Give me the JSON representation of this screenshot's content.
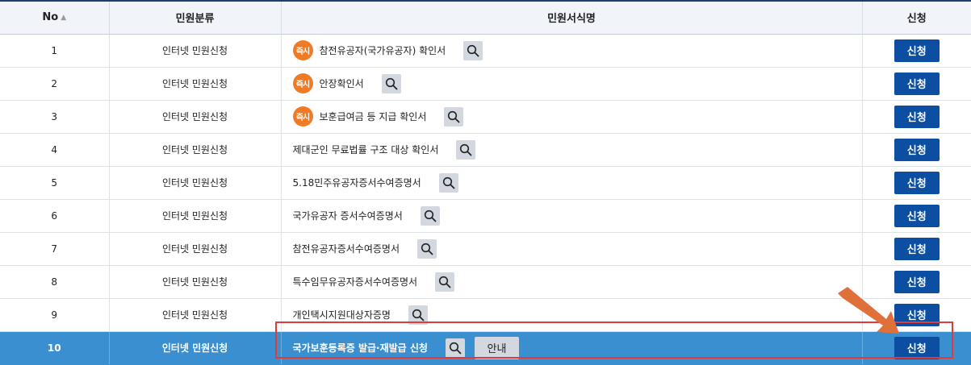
{
  "header": {
    "col_no": "No",
    "col_category": "민원분류",
    "col_form": "민원서식명",
    "col_apply": "신청"
  },
  "badge_label": "즉시",
  "apply_label": "신청",
  "guide_label": "안내",
  "rows": [
    {
      "no": "1",
      "category": "인터넷 민원신청",
      "title": "참전유공자(국가유공자) 확인서",
      "instant": true
    },
    {
      "no": "2",
      "category": "인터넷 민원신청",
      "title": "안장확인서",
      "instant": true
    },
    {
      "no": "3",
      "category": "인터넷 민원신청",
      "title": "보훈급여금 등 지급 확인서",
      "instant": true
    },
    {
      "no": "4",
      "category": "인터넷 민원신청",
      "title": "제대군인 무료법률 구조 대상 확인서",
      "instant": false
    },
    {
      "no": "5",
      "category": "인터넷 민원신청",
      "title": "5.18민주유공자증서수여증명서",
      "instant": false
    },
    {
      "no": "6",
      "category": "인터넷 민원신청",
      "title": "국가유공자 증서수여증명서",
      "instant": false
    },
    {
      "no": "7",
      "category": "인터넷 민원신청",
      "title": "참전유공자증서수여증명서",
      "instant": false
    },
    {
      "no": "8",
      "category": "인터넷 민원신청",
      "title": "특수임무유공자증서수여증명서",
      "instant": false
    },
    {
      "no": "9",
      "category": "인터넷 민원신청",
      "title": "개인택시지원대상자증명",
      "instant": false
    },
    {
      "no": "10",
      "category": "인터넷 민원신청",
      "title": "국가보훈등록증 발급·재발급 신청",
      "instant": false,
      "selected": true,
      "has_guide": true
    }
  ],
  "colors": {
    "badge": "#f07b24",
    "apply_button": "#0b4ea2",
    "selected_row": "#3a8fd0",
    "highlight_border": "#e03a3a",
    "arrow": "#e0703a"
  },
  "icons": {
    "sort": "sort-icon",
    "search": "magnifier-icon",
    "pointer": "arrow-pointer-icon"
  }
}
